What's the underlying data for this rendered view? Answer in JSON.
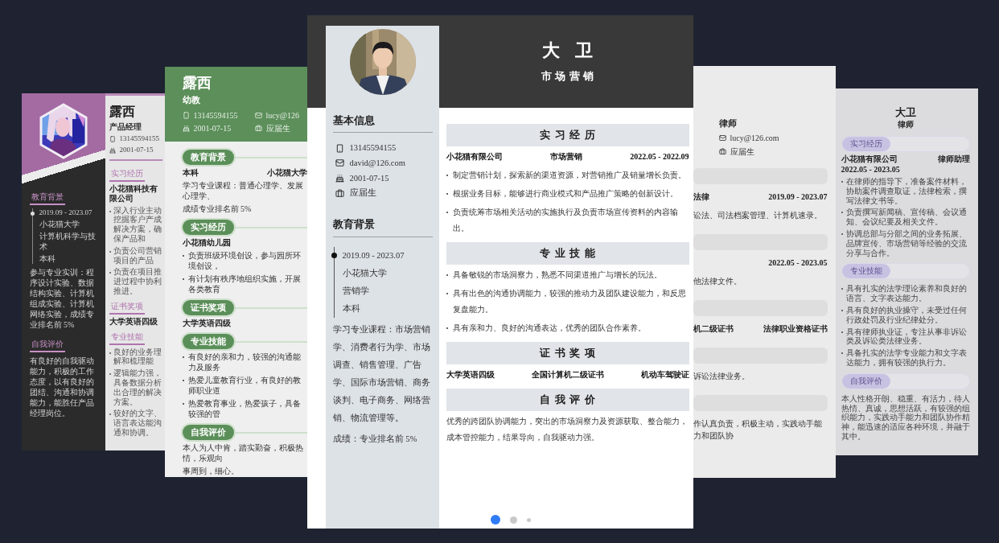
{
  "cards": [
    {
      "kind": "dark-sidebar",
      "side_sections": [
        {
          "title": "教育背景",
          "timeline": [
            "2019.09 - 2023.07",
            "小花猫大学",
            "计算机科学与技术",
            "本科"
          ],
          "lines": [
            "参与专业实训：程序设计实验、数据结构实验、计算机组成实验、计算机网络实验，成绩专业排名前 5%"
          ]
        },
        {
          "title": "自我评价",
          "lines": [
            "有良好的自我驱动能力，积极的工作态度，以有良好的团结、沟通和协调能力，能胜任产品经理岗位。"
          ]
        }
      ],
      "name": "露西",
      "role": "产品经理",
      "contacts": [
        {
          "kind": "phone",
          "text": "13145594155"
        },
        {
          "kind": "birthday",
          "text": "2001-07-15"
        }
      ],
      "sections": [
        {
          "title": "实习经历",
          "rows": [
            [
              "小花猫科技有限公司"
            ]
          ],
          "bullets": [
            "深入行业主动挖掘客户产成解决方案，确保产品和",
            "负责公司营销项目的产品",
            "负责在项目推进过程中协利推进。"
          ]
        },
        {
          "title": "证书奖项",
          "rows": [
            [
              "大学英语四级"
            ]
          ]
        },
        {
          "title": "专业技能",
          "bullets": [
            "良好的业务理解和梳理能",
            "逻辑能力强，具备数据分析出合理的解决方案。",
            "较好的文字、语言表达能沟通和协调。"
          ]
        }
      ]
    },
    {
      "kind": "green-header",
      "name": "露西",
      "role": "幼教",
      "contacts": [
        {
          "kind": "phone",
          "text": "13145594155"
        },
        {
          "kind": "email",
          "text": "lucy@126"
        },
        {
          "kind": "birthday",
          "text": "2001-07-15"
        },
        {
          "kind": "status",
          "text": "应届生"
        }
      ],
      "sections": [
        {
          "title": "教育背景",
          "rows": [
            [
              "本科",
              "小花猫大学"
            ]
          ],
          "lines": [
            "学习专业课程：普通心理学、发展心理学、",
            "成绩专业排名前 5%"
          ]
        },
        {
          "title": "实习经历",
          "rows": [
            [
              "小花猫幼儿园"
            ]
          ],
          "bullets": [
            "负责班级环境创设，参与园所环境创设，",
            "有计划有秩序地组织实施，开展各类教育"
          ]
        },
        {
          "title": "证书奖项",
          "rows": [
            [
              "大学英语四级"
            ]
          ]
        },
        {
          "title": "专业技能",
          "bullets": [
            "有良好的亲和力，较强的沟通能力及服务",
            "热爱儿童教育行业，有良好的教师职业道",
            "热爱教育事业，热爱孩子，具备较强的管"
          ]
        },
        {
          "title": "自我评价",
          "lines": [
            "本人为人中肯，踏实勤奋，积极热情，乐观向",
            "事周到，细心。"
          ]
        }
      ]
    },
    {
      "kind": "featured",
      "name": "大卫",
      "role": "市场营销",
      "info_title": "基本信息",
      "contacts": [
        {
          "kind": "phone",
          "text": "13145594155"
        },
        {
          "kind": "email",
          "text": "david@126.com"
        },
        {
          "kind": "birthday",
          "text": "2001-07-15"
        },
        {
          "kind": "status",
          "text": "应届生"
        }
      ],
      "edu_title": "教育背景",
      "timeline": [
        "2019.09 - 2023.07",
        "小花猫大学",
        "营销学",
        "本科"
      ],
      "side_lines": [
        "学习专业课程：市场营销学、消费者行为学、市场调查、销售管理、广告学、国际市场营销、商务谈判、电子商务、网络营销、物流管理等。",
        "成绩：专业排名前 5%"
      ],
      "sections": [
        {
          "title": "实习经历",
          "rows": [
            [
              "小花猫有限公司",
              "市场营销",
              "2022.05 - 2022.09"
            ]
          ],
          "bullets": [
            "制定营销计划，探索新的渠道资源，对营销推广及销量增长负责。",
            "根据业务目标，能够进行商业模式和产品推广策略的创新设计。",
            "负责统筹市场相关活动的实施执行及负责市场宣传资料的内容输出。"
          ]
        },
        {
          "title": "专业技能",
          "bullets": [
            "具备敏锐的市场洞察力，熟悉不同渠道推广与增长的玩法。",
            "具有出色的沟通协调能力，较强的推动力及团队建设能力，和反思复盘能力。",
            "具有亲和力、良好的沟通表达，优秀的团队合作素养。"
          ]
        },
        {
          "title": "证书奖项",
          "rows": [
            [
              "大学英语四级",
              "全国计算机二级证书",
              "机动车驾驶证"
            ]
          ]
        },
        {
          "title": "自我评价",
          "lines": [
            "优秀的跨团队协调能力，突出的市场洞察力及资源获取、整合能力，成本管控能力，结果导向，自我驱动力强。"
          ]
        }
      ]
    },
    {
      "kind": "plain-gray",
      "role": "律师",
      "contacts": [
        {
          "kind": "email",
          "text": "lucy@126.com"
        },
        {
          "kind": "status",
          "text": "应届生"
        }
      ],
      "sections": [
        {
          "rows": [
            [
              "法律",
              "2019.09 - 2023.07"
            ]
          ],
          "lines": [
            "讼法、司法档案管理、计算机速录。"
          ]
        },
        {
          "rows": [
            [
              "2022.05 - 2023.05"
            ]
          ],
          "lines": [
            "他法律文件。"
          ]
        },
        {
          "rows": [
            [
              "机二级证书",
              "法律职业资格证书"
            ]
          ]
        },
        {
          "lines": [
            "诉讼法律业务。"
          ]
        },
        {
          "lines": [
            "作认真负责，积极主动，实践动手能力和团队协"
          ]
        }
      ]
    },
    {
      "kind": "lavender-pill",
      "name": "大卫",
      "role": "律师",
      "sections": [
        {
          "title": "实习经历",
          "rows": [
            [
              "小花猫有限公司",
              "律师助理",
              "2022.05 - 2023.05"
            ]
          ],
          "bullets": [
            "在律师的指导下，准备案件材料，协助案件调查取证，法律检索，撰写法律文书等。",
            "负责撰写新闻稿、宣传稿、会议通知、会议纪要及相关文件。",
            "协调总部与分部之间的业务拓展、品牌宣传、市场营销等经验的交流分享与合作。"
          ]
        },
        {
          "title": "专业技能",
          "bullets": [
            "具有扎实的法学理论素养和良好的语言、文字表达能力。",
            "具有良好的执业操守，未受过任何行政处罚及行业纪律处分。",
            "具有律师执业证，专注从事非诉讼类及诉讼类法律业务。",
            "具备扎实的法学专业能力和文字表达能力，拥有较强的执行力。"
          ]
        },
        {
          "title": "自我评价",
          "lines": [
            "本人性格开朗、稳重、有活力，待人热情、真诚，思想活跃，有较强的组织能力，实践动手能力和团队协作精神，能迅速的适应各种环境，并融于其中。"
          ]
        }
      ]
    }
  ],
  "pagination": [
    {
      "selected": true
    },
    {
      "selected": false
    },
    {
      "selected": false
    }
  ]
}
